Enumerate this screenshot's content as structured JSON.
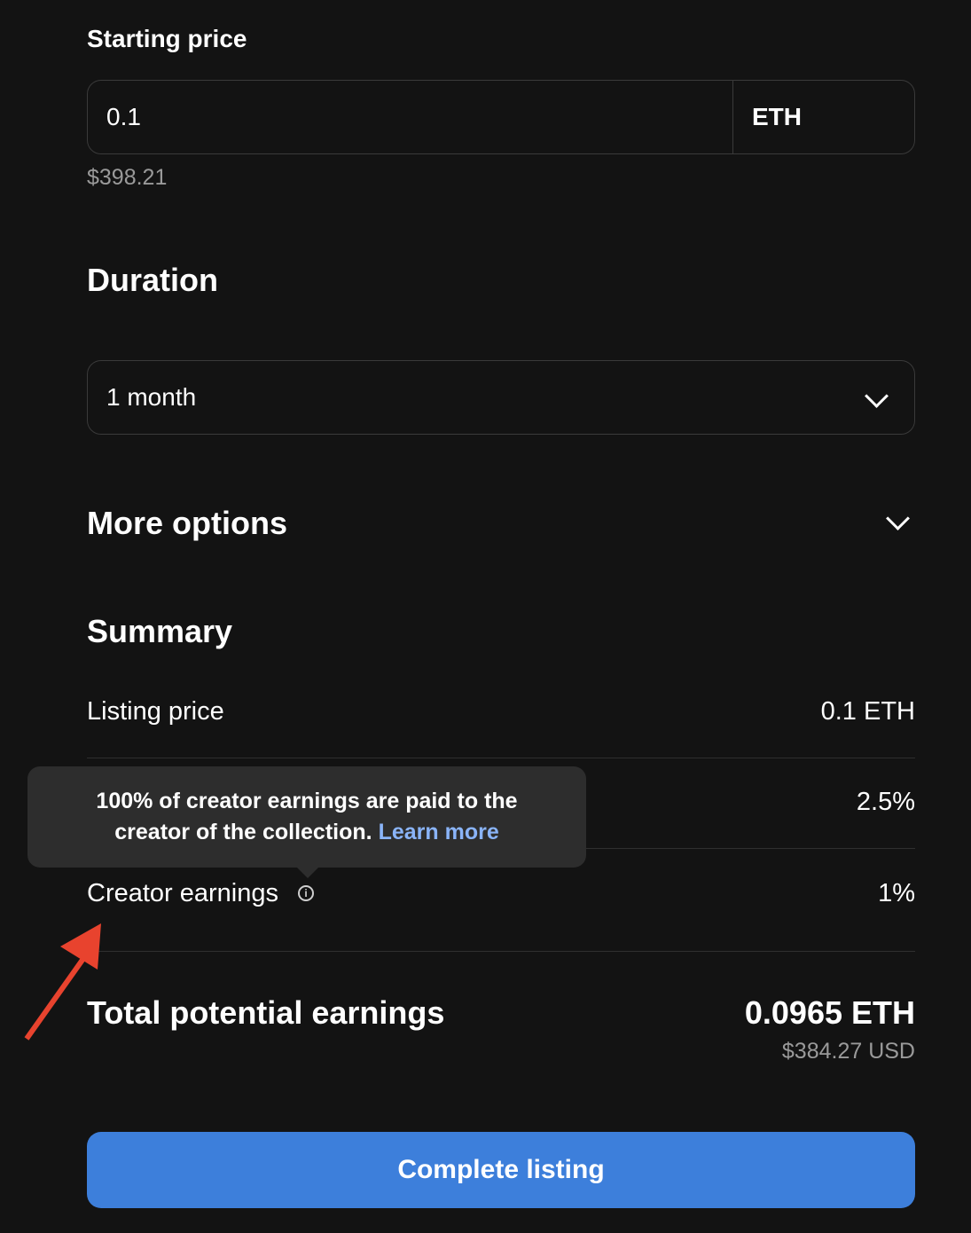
{
  "price": {
    "heading": "Starting price",
    "value": "0.1",
    "currency": "ETH",
    "usd": "$398.21"
  },
  "duration": {
    "heading": "Duration",
    "selected": "1 month"
  },
  "more_options": {
    "heading": "More options"
  },
  "summary": {
    "heading": "Summary",
    "rows": [
      {
        "label": "Listing price",
        "value": "0.1 ETH"
      },
      {
        "label": "",
        "value": "2.5%"
      },
      {
        "label": "Creator earnings",
        "value": "1%"
      }
    ]
  },
  "tooltip": {
    "line1": "100% of creator earnings are paid to the",
    "line2": "creator of the collection.",
    "link": "Learn more"
  },
  "total": {
    "label": "Total potential earnings",
    "eth": "0.0965 ETH",
    "usd": "$384.27 USD"
  },
  "cta": {
    "label": "Complete listing"
  },
  "colors": {
    "background": "#131313",
    "accent": "#3d7fdb",
    "link": "#8ab4f8",
    "annotation_arrow": "#e8432e"
  },
  "icons": [
    "chevron-down-icon",
    "info-icon",
    "annotation-arrow-icon"
  ]
}
